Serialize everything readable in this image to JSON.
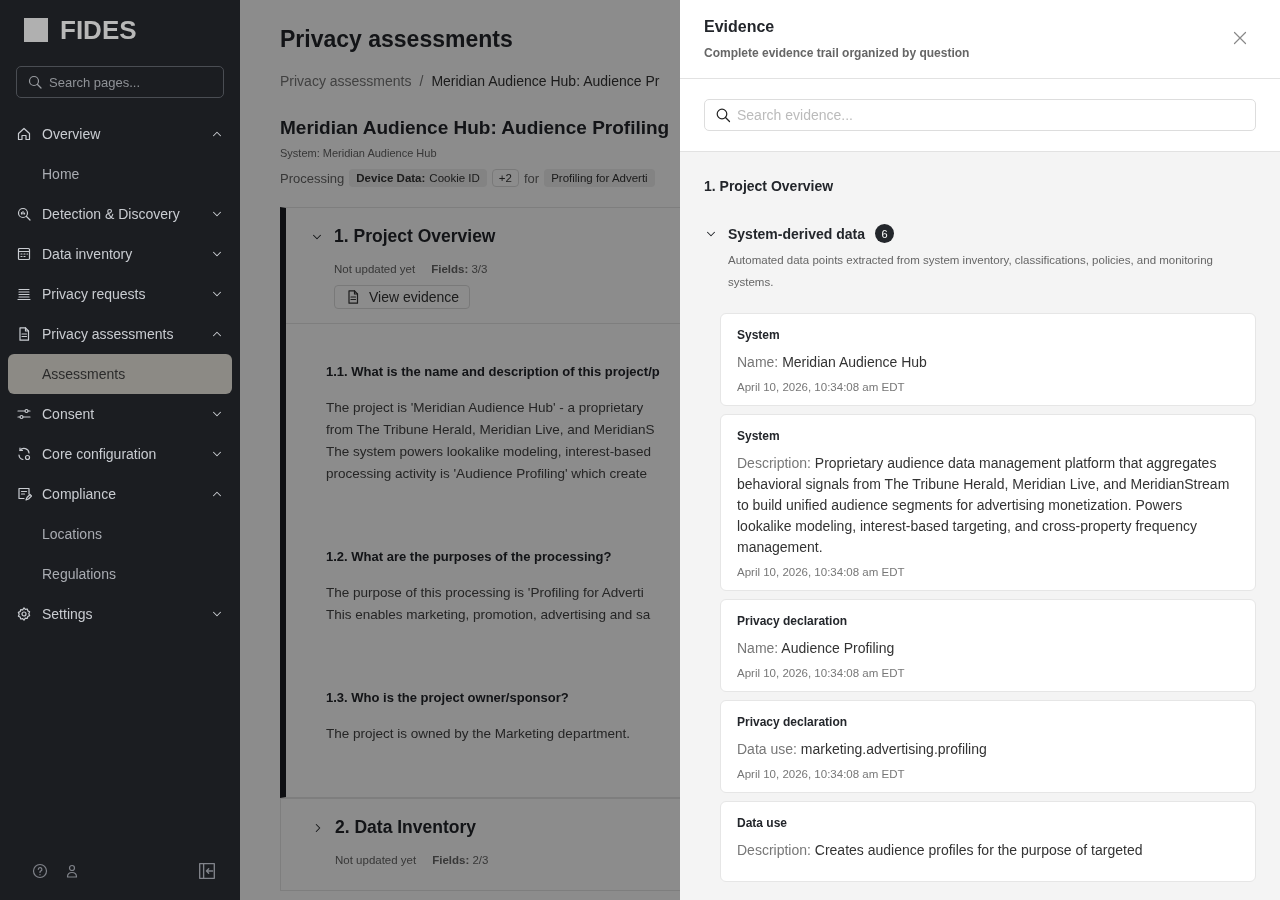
{
  "sidebar": {
    "logo": "FIDES",
    "search": {
      "placeholder": "Search pages..."
    },
    "items": [
      {
        "label": "Overview",
        "expanded": true,
        "children": [
          {
            "label": "Home",
            "selected": false
          }
        ]
      },
      {
        "label": "Detection & Discovery",
        "expanded": false
      },
      {
        "label": "Data inventory",
        "expanded": false
      },
      {
        "label": "Privacy requests",
        "expanded": false
      },
      {
        "label": "Privacy assessments",
        "expanded": true,
        "children": [
          {
            "label": "Assessments",
            "selected": true
          }
        ]
      },
      {
        "label": "Consent",
        "expanded": false
      },
      {
        "label": "Core configuration",
        "expanded": false
      },
      {
        "label": "Compliance",
        "expanded": true,
        "children": [
          {
            "label": "Locations",
            "selected": false
          },
          {
            "label": "Regulations",
            "selected": false
          }
        ]
      },
      {
        "label": "Settings",
        "expanded": false
      }
    ]
  },
  "page": {
    "title": "Privacy assessments",
    "breadcrumb": [
      "Privacy assessments",
      "Meridian Audience Hub: Audience Pr"
    ],
    "breadcrumb_separator": "/",
    "heading": "Meridian Audience Hub: Audience Profiling",
    "system": "System: Meridian Audience Hub",
    "processing": {
      "label": "Processing",
      "tag_key": "Device Data:",
      "tag_value": "Cookie ID",
      "more": "+2",
      "connector": "for",
      "purpose": "Profiling for Adverti"
    },
    "sections": [
      {
        "title": "1. Project Overview",
        "expanded": true,
        "status": "Not updated yet",
        "fields": "**Fields:** 3/3",
        "button": "View evidence",
        "questions": [
          {
            "question": "1.1. What is the name and description of this project/p",
            "answer_lines": [
              "The project is 'Meridian Audience Hub' - a proprietary",
              "from The Tribune Herald, Meridian Live, and MeridianS",
              "The system powers lookalike modeling, interest-based",
              "processing activity is 'Audience Profiling' which create"
            ]
          },
          {
            "question": "1.2. What are the purposes of the processing?",
            "answer_lines": [
              "The purpose of this processing is 'Profiling for Adverti",
              "This enables marketing, promotion, advertising and sa"
            ]
          },
          {
            "question": "1.3. Who is the project owner/sponsor?",
            "answer_lines": [
              "The project is owned by the Marketing department."
            ]
          }
        ]
      },
      {
        "title": "2. Data Inventory",
        "expanded": false,
        "status": "Not updated yet",
        "fields": "**Fields:** 2/3"
      }
    ]
  },
  "drawer": {
    "title": "Evidence",
    "subtitle": "Complete evidence trail organized by question",
    "search": {
      "placeholder": "Search evidence..."
    },
    "question": "1. Project Overview",
    "group": {
      "title": "System-derived data",
      "count": "6",
      "expanded": true,
      "description": "Automated data points extracted from system inventory, classifications, policies, and monitoring systems."
    },
    "cards": [
      {
        "source": "System",
        "field": "Name:",
        "value": "Meridian Audience Hub",
        "time": "April 10, 2026, 10:34:08 am EDT"
      },
      {
        "source": "System",
        "field": "Description:",
        "value": "Proprietary audience data management platform that aggregates behavioral signals from The Tribune Herald, Meridian Live, and MeridianStream to build unified audience segments for advertising monetization. Powers lookalike modeling, interest-based targeting, and cross-property frequency management.",
        "time": "April 10, 2026, 10:34:08 am EDT"
      },
      {
        "source": "Privacy declaration",
        "field": "Name:",
        "value": "Audience Profiling",
        "time": "April 10, 2026, 10:34:08 am EDT"
      },
      {
        "source": "Privacy declaration",
        "field": "Data use:",
        "value": "marketing.advertising.profiling",
        "time": "April 10, 2026, 10:34:08 am EDT"
      },
      {
        "source": "Data use",
        "field": "Description:",
        "value": "Creates audience profiles for the purpose of targeted"
      }
    ]
  }
}
